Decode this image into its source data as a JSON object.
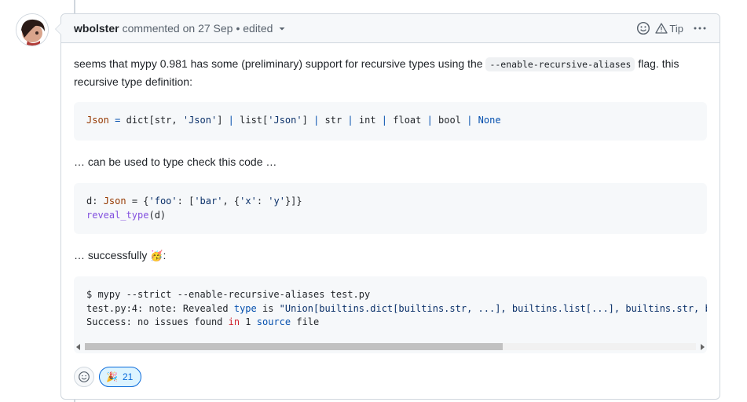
{
  "comment": {
    "author": "wbolster",
    "meta": "commented on 27 Sep",
    "edited": "• edited",
    "tip_label": "Tip",
    "para1_pre": "seems that mypy 0.981 has some (preliminary) support for recursive types using the ",
    "para1_code": "--enable-recursive-aliases",
    "para1_post": " flag. this recursive type definition:",
    "para2": "… can be used to type check this code …",
    "para3": "… successfully",
    "para3_colon": ":",
    "code1": {
      "name": "Json",
      "eq": " = ",
      "rest1": "dict[str, ",
      "s1": "'Json'",
      "rest2": "] ",
      "p1": "|",
      "rest3": " list[",
      "s2": "'Json'",
      "rest4": "] ",
      "p2": "|",
      "rest5": " str ",
      "p3": "|",
      "rest6": " int ",
      "p4": "|",
      "rest7": " float ",
      "p5": "|",
      "rest8": " bool ",
      "p6": "|",
      "none": " None"
    },
    "code2": {
      "l1_a": "d: ",
      "l1_type": "Json",
      "l1_b": " = {",
      "l1_s1": "'foo'",
      "l1_c": ": [",
      "l1_s2": "'bar'",
      "l1_d": ", {",
      "l1_s3": "'x'",
      "l1_e": ": ",
      "l1_s4": "'y'",
      "l1_f": "}]}",
      "l2_fn": "reveal_type",
      "l2_rest": "(d)"
    },
    "code3": {
      "l1": "$ mypy --strict --enable-recursive-aliases test.py",
      "l2_a": "test.py:4: note: Revealed ",
      "l2_kw": "type",
      "l2_b": " is ",
      "l2_s": "\"Union[builtins.dict[builtins.str, ...], builtins.list[...], builtins.str, builtins.int, builtins.float, builtins.bool, None]\"",
      "l3_a": "Success: no issues found ",
      "l3_kw": "in",
      "l3_b": " 1 ",
      "l3_kw2": "source",
      "l3_c": " file"
    },
    "reactions": [
      {
        "emoji": "🎉",
        "count": "21"
      }
    ]
  },
  "icons": {
    "smiley": "smiley-icon",
    "tip": "alert-icon",
    "more": "kebab-horizontal-icon"
  },
  "colors": {
    "accent": "#0969da",
    "border": "#d0d7de",
    "header_bg": "#f6f8fa"
  }
}
